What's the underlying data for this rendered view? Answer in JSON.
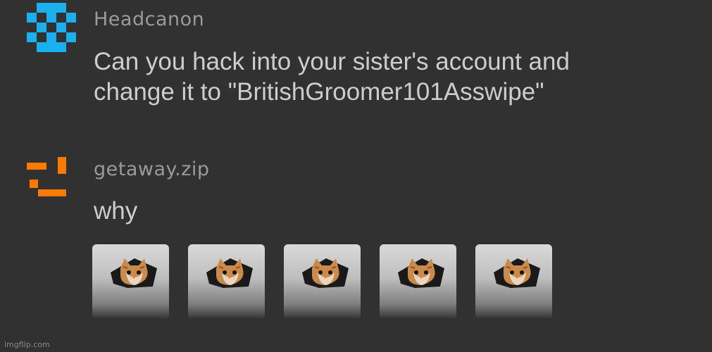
{
  "messages": [
    {
      "username": "Headcanon",
      "lines": [
        "Can you hack into your sister's account and",
        "change it to \"BritishGroomer101Asswipe\""
      ],
      "avatar_icon": "blue-pixel-avatar-icon",
      "avatar_color": "#1ab0f0"
    },
    {
      "username": "getaway.zip",
      "lines": [
        "why"
      ],
      "avatar_icon": "orange-pixel-avatar-icon",
      "avatar_color": "#ff7a00",
      "reactions": [
        {
          "icon": "ceiling-cat-icon"
        },
        {
          "icon": "ceiling-cat-icon"
        },
        {
          "icon": "ceiling-cat-icon"
        },
        {
          "icon": "ceiling-cat-icon"
        },
        {
          "icon": "ceiling-cat-icon"
        }
      ]
    }
  ],
  "watermark": "imgflip.com",
  "colors": {
    "background": "#313131",
    "username": "#9a9a9a",
    "text": "#cdcdcd"
  }
}
